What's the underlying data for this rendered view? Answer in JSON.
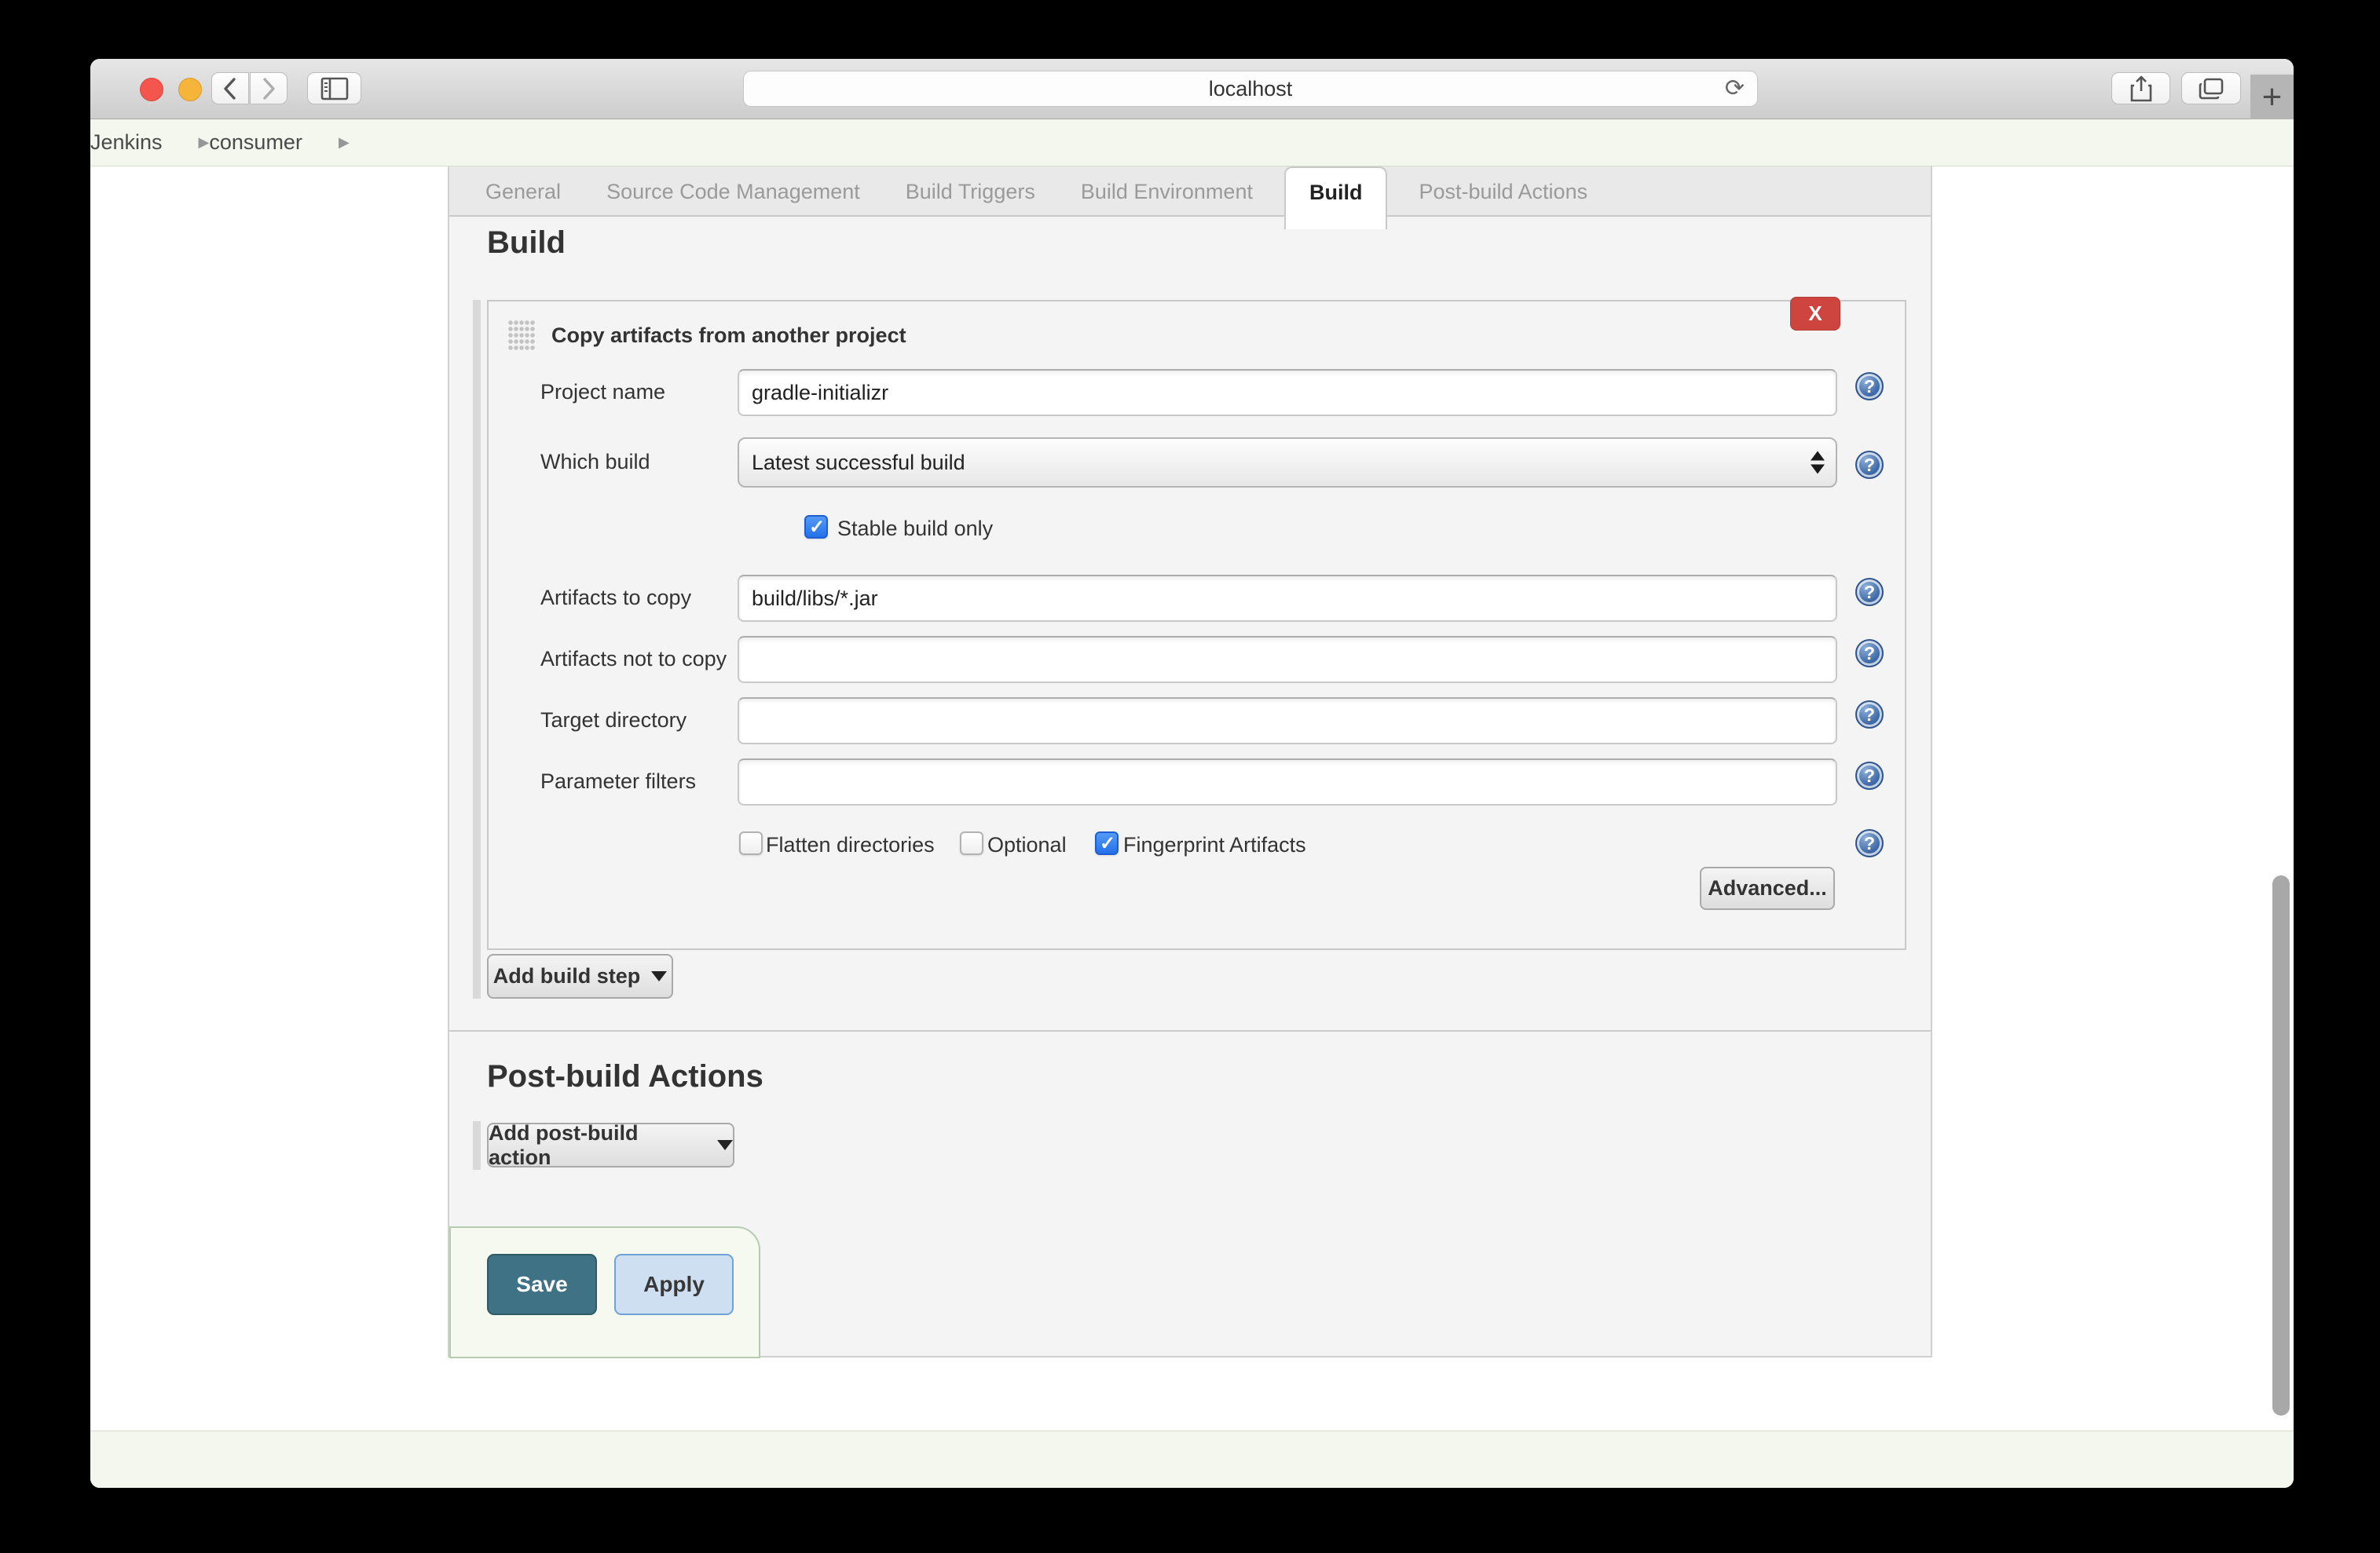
{
  "browser": {
    "url": "localhost",
    "new_tab_label": "+",
    "breadcrumb": {
      "item1": "Jenkins",
      "item2": "consumer"
    }
  },
  "tabs": {
    "general": "General",
    "scm": "Source Code Management",
    "triggers": "Build Triggers",
    "environment": "Build Environment",
    "build": "Build",
    "post_build": "Post-build Actions"
  },
  "build": {
    "heading": "Build",
    "step": {
      "title": "Copy artifacts from another project",
      "close_label": "X",
      "fields": [
        {
          "label": "Project name",
          "value": "gradle-initializr"
        },
        {
          "label": "Which build",
          "value": "Latest successful build"
        },
        {
          "label": "Artifacts to copy",
          "value": "build/libs/*.jar"
        },
        {
          "label": "Artifacts not to copy",
          "value": ""
        },
        {
          "label": "Target directory",
          "value": ""
        },
        {
          "label": "Parameter filters",
          "value": ""
        }
      ],
      "stable_build_only": {
        "label": "Stable build only",
        "checked": true
      },
      "options": [
        {
          "label": "Flatten directories",
          "checked": false
        },
        {
          "label": "Optional",
          "checked": false
        },
        {
          "label": "Fingerprint Artifacts",
          "checked": true
        }
      ],
      "advanced_label": "Advanced..."
    },
    "add_build_step_label": "Add build step"
  },
  "post_build": {
    "heading": "Post-build Actions",
    "add_action_label": "Add post-build action"
  },
  "footer_actions": {
    "save": "Save",
    "apply": "Apply"
  },
  "colors": {
    "save_button": "#3f7284",
    "apply_button": "#cfdff2",
    "close_button": "#ce453f",
    "checkbox_checked": "#2470e9",
    "help_icon": "#3d69a6",
    "breadcrumb_bar": "#f4f7ed",
    "tab_bar": "#e9e9e9"
  }
}
